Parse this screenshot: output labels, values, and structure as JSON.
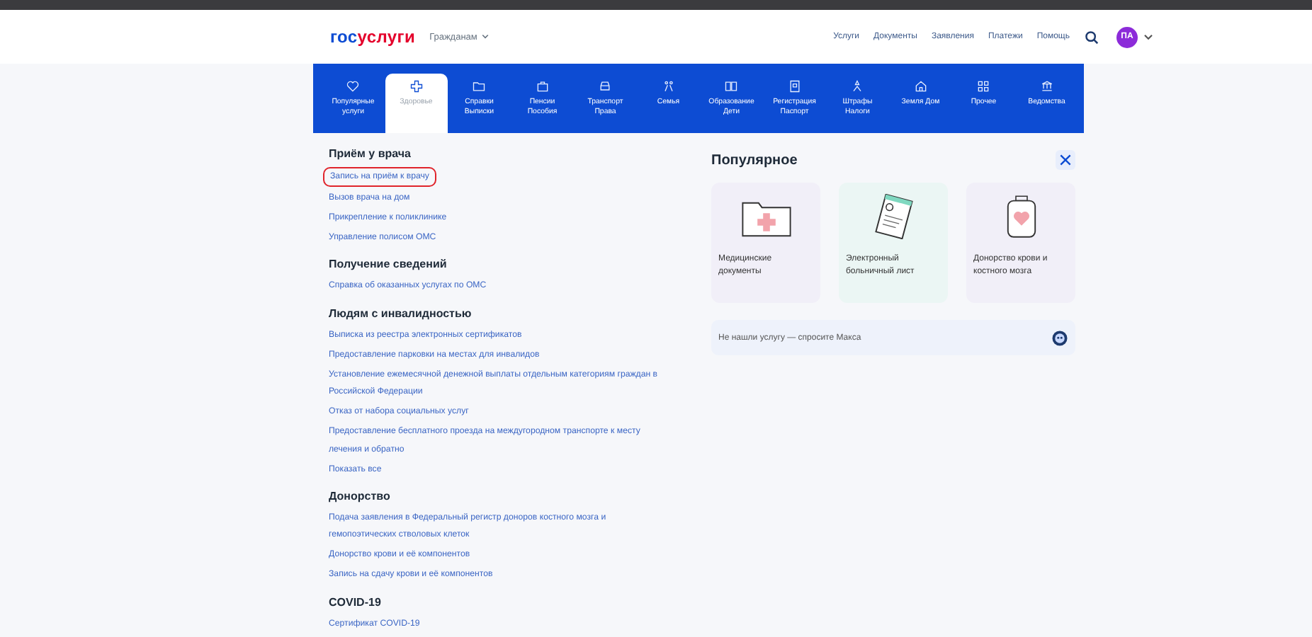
{
  "header": {
    "logo": {
      "prefix": "гос",
      "suffix": "услуги"
    },
    "audience": "Гражданам",
    "links": [
      "Услуги",
      "Документы",
      "Заявления",
      "Платежи",
      "Помощь"
    ],
    "avatar": "ПА"
  },
  "tabs": [
    {
      "label": "Популярные услуги",
      "selected": false
    },
    {
      "label": "Здоровье",
      "selected": true
    },
    {
      "label": "Справки Выписки",
      "selected": false
    },
    {
      "label": "Пенсии Пособия",
      "selected": false
    },
    {
      "label": "Транспорт Права",
      "selected": false
    },
    {
      "label": "Семья",
      "selected": false
    },
    {
      "label": "Образование Дети",
      "selected": false
    },
    {
      "label": "Регистрация Паспорт",
      "selected": false
    },
    {
      "label": "Штрафы Налоги",
      "selected": false
    },
    {
      "label": "Земля Дом",
      "selected": false
    },
    {
      "label": "Прочее",
      "selected": false
    },
    {
      "label": "Ведомства",
      "selected": false
    }
  ],
  "sections": [
    {
      "title": "Приём у врача",
      "links": [
        {
          "text": "Запись на приём к врачу",
          "circled": true
        },
        {
          "text": "Вызов врача на дом",
          "circled": false
        },
        {
          "text": "Прикрепление к поликлинике",
          "circled": false
        },
        {
          "text": "Управление полисом ОМС",
          "circled": false
        }
      ]
    },
    {
      "title": "Получение сведений",
      "links": [
        {
          "text": "Справка об оказанных услугах по ОМС",
          "circled": false
        }
      ]
    },
    {
      "title": "Людям с инвалидностью",
      "links": [
        {
          "text": "Выписка из реестра электронных сертификатов",
          "circled": false
        },
        {
          "text": "Предоставление парковки на местах для инвалидов",
          "circled": false
        },
        {
          "text": "Установление ежемесячной денежной выплаты отдельным категориям граждан в Российской Федерации",
          "circled": false
        },
        {
          "text": "Отказ от набора социальных услуг",
          "circled": false
        },
        {
          "text": "Предоставление бесплатного проезда на междугородном транспорте к месту лечения и обратно",
          "circled": false
        },
        {
          "text": "Показать все",
          "circled": false
        }
      ]
    },
    {
      "title": "Донорство",
      "links": [
        {
          "text": "Подача заявления в Федеральный регистр доноров костного мозга и гемопоэтических стволовых клеток",
          "circled": false
        },
        {
          "text": "Донорство крови и её компонентов",
          "circled": false
        },
        {
          "text": "Запись на сдачу крови и её компонентов",
          "circled": false
        }
      ]
    },
    {
      "title": "COVID-19",
      "links": [
        {
          "text": "Сертификат COVID-19",
          "circled": false
        }
      ]
    }
  ],
  "popular": {
    "title": "Популярное",
    "cards": [
      {
        "kind": "folder",
        "label": "Медицинские документы"
      },
      {
        "kind": "sheet",
        "label": "Электронный больничный лист"
      },
      {
        "kind": "blood",
        "label": "Донорство крови и костного мозга"
      }
    ],
    "ask": "Не нашли услугу — спросите Макса"
  }
}
